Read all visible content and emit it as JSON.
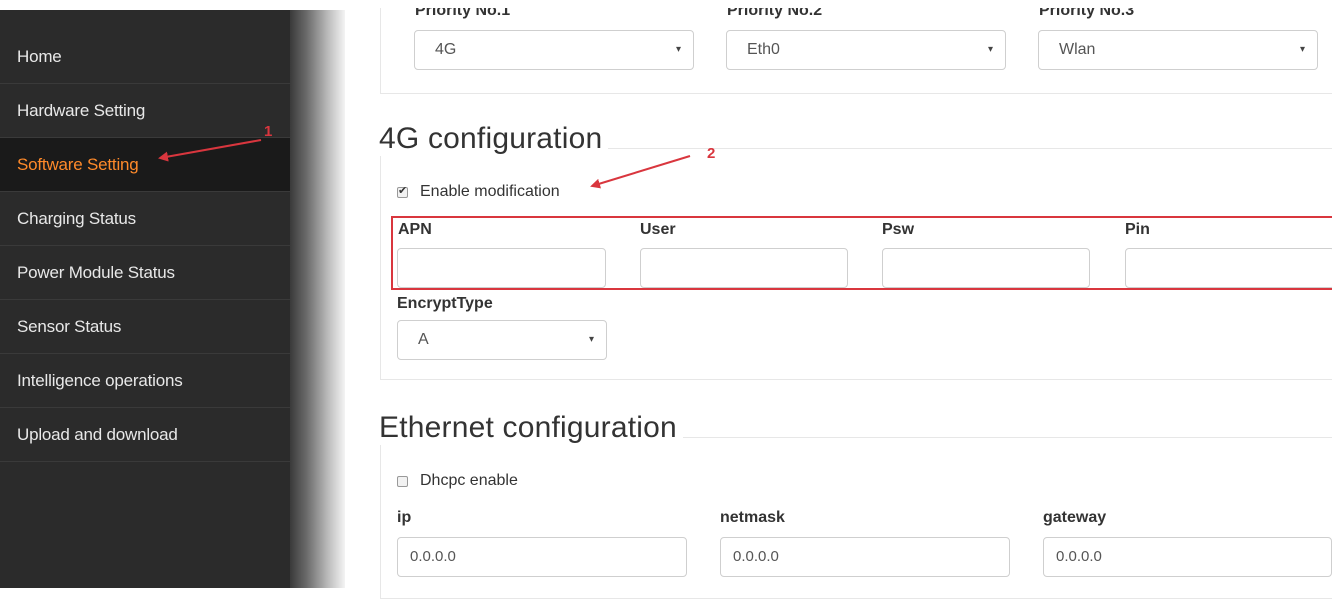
{
  "sidebar": {
    "items": [
      {
        "label": "Home",
        "active": false
      },
      {
        "label": "Hardware Setting",
        "active": false
      },
      {
        "label": "Software Setting",
        "active": true
      },
      {
        "label": "Charging Status",
        "active": false
      },
      {
        "label": "Power Module Status",
        "active": false
      },
      {
        "label": "Sensor Status",
        "active": false
      },
      {
        "label": "Intelligence operations",
        "active": false
      },
      {
        "label": "Upload and download",
        "active": false
      }
    ]
  },
  "priority": {
    "labels": [
      "Priority No.1",
      "Priority No.2",
      "Priority No.3"
    ],
    "values": [
      "4G",
      "Eth0",
      "Wlan"
    ]
  },
  "config_4g": {
    "title": "4G configuration",
    "enable_label": "Enable modification",
    "enable_checked": true,
    "fields": [
      {
        "label": "APN",
        "value": ""
      },
      {
        "label": "User",
        "value": ""
      },
      {
        "label": "Psw",
        "value": ""
      },
      {
        "label": "Pin",
        "value": ""
      }
    ],
    "encrypt_label": "EncryptType",
    "encrypt_value": "A"
  },
  "ethernet": {
    "title": "Ethernet configuration",
    "dhcp_label": "Dhcpc enable",
    "dhcp_checked": false,
    "fields": [
      {
        "label": "ip",
        "value": "0.0.0.0"
      },
      {
        "label": "netmask",
        "value": "0.0.0.0"
      },
      {
        "label": "gateway",
        "value": "0.0.0.0"
      }
    ]
  },
  "annotations": {
    "marker_1": "1",
    "marker_2": "2",
    "color": "#d9363e"
  },
  "colors": {
    "sidebar_bg": "#2b2b2b",
    "active_text": "#ff8a2a"
  },
  "icons": {
    "select_caret": "▾"
  }
}
